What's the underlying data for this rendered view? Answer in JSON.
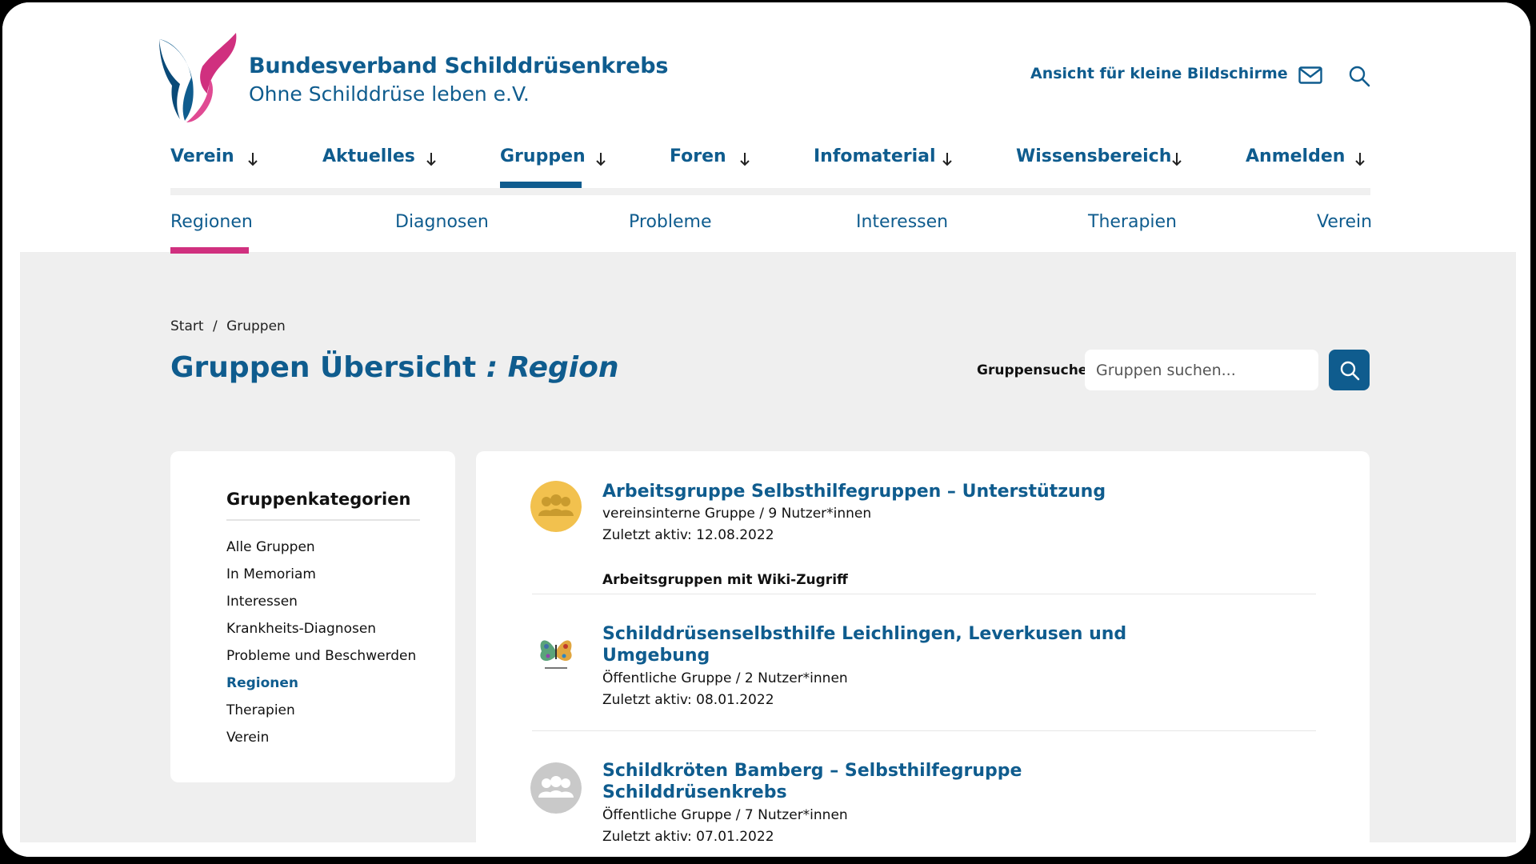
{
  "header": {
    "brand_name": "Bundesverband Schilddrüsenkrebs",
    "brand_sub": "Ohne Schilddrüse leben e.V.",
    "small_screen_link": "Ansicht für kleine Bildschirme",
    "mail_icon": "mail-icon",
    "search_icon": "search-icon"
  },
  "main_nav": [
    {
      "label": "Verein"
    },
    {
      "label": "Aktuelles"
    },
    {
      "label": "Gruppen",
      "active": true
    },
    {
      "label": "Foren"
    },
    {
      "label": "Infomaterial"
    },
    {
      "label": "Wissensbereich"
    },
    {
      "label": "Anmelden"
    }
  ],
  "sub_nav": [
    {
      "label": "Regionen",
      "active": true
    },
    {
      "label": "Diagnosen"
    },
    {
      "label": "Probleme"
    },
    {
      "label": "Interessen"
    },
    {
      "label": "Therapien"
    },
    {
      "label": "Verein"
    }
  ],
  "breadcrumb": {
    "start": "Start",
    "separator": "/",
    "current": "Gruppen"
  },
  "page_title": {
    "main": "Gruppen Übersicht",
    "suffix": ": Region"
  },
  "search": {
    "label": "Gruppensuche",
    "placeholder": "Gruppen suchen..."
  },
  "sidebar": {
    "title": "Gruppenkategorien",
    "items": [
      {
        "label": "Alle Gruppen"
      },
      {
        "label": "In Memoriam"
      },
      {
        "label": "Interessen"
      },
      {
        "label": "Krankheits-Diagnosen"
      },
      {
        "label": "Probleme und Beschwerden"
      },
      {
        "label": "Regionen",
        "active": true
      },
      {
        "label": "Therapien"
      },
      {
        "label": "Verein"
      }
    ]
  },
  "groups": [
    {
      "title": "Arbeitsgruppe Selbsthilfegruppen – Unterstützung",
      "meta": "vereinsinterne Gruppe / 9 Nutzer*innen",
      "last_active": "Zuletzt aktiv: 12.08.2022",
      "note": "Arbeitsgruppen mit Wiki-Zugriff",
      "avatar_color": "#f2c14e"
    },
    {
      "title_line1": "Schilddrüsenselbsthilfe Leichlingen, Leverkusen und",
      "title_line2": "Umgebung",
      "meta": "Öffentliche Gruppe / 2 Nutzer*innen",
      "last_active": "Zuletzt aktiv: 08.01.2022"
    },
    {
      "title_line1": "Schildkröten Bamberg – Selbsthilfegruppe",
      "title_line2": "Schilddrüsenkrebs",
      "meta": "Öffentliche Gruppe / 7 Nutzer*innen",
      "last_active": "Zuletzt aktiv: 07.01.2022",
      "avatar_color": "#c9c9c9"
    }
  ],
  "colors": {
    "brand_blue": "#0f5c8e",
    "accent_pink": "#d0307f"
  }
}
